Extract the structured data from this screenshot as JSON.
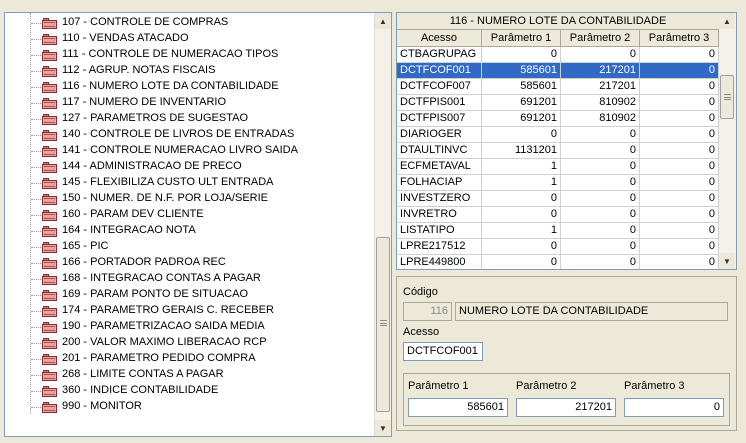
{
  "tree": {
    "items": [
      "107 - CONTROLE DE COMPRAS",
      "110 - VENDAS ATACADO",
      "111 - CONTROLE DE NUMERACAO TIPOS",
      "112 - AGRUP. NOTAS FISCAIS",
      "116 - NUMERO LOTE DA CONTABILIDADE",
      "117 - NUMERO DE INVENTARIO",
      "127 - PARAMETROS DE SUGESTAO",
      "140 - CONTROLE DE LIVROS DE ENTRADAS",
      "141 - CONTROLE NUMERACAO LIVRO SAIDA",
      "144 - ADMINISTRACAO DE PRECO",
      "145 - FLEXIBILIZA CUSTO ULT ENTRADA",
      "150 - NUMER. DE N.F. POR LOJA/SERIE",
      "160 - PARAM DEV CLIENTE",
      "164 - INTEGRACAO NOTA",
      "165 - PIC",
      "166 - PORTADOR PADROA REC",
      "168 - INTEGRACAO CONTAS A PAGAR",
      "169 - PARAM PONTO DE SITUACAO",
      "174 - PARAMETRO GERAIS C. RECEBER",
      "190 - PARAMETRIZACAO SAIDA MEDIA",
      "200 - VALOR MAXIMO LIBERACAO RCP",
      "201 - PARAMETRO PEDIDO COMPRA",
      "268 - LIMITE CONTAS A PAGAR",
      "360 - INDICE CONTABILIDADE",
      "990 - MONITOR"
    ]
  },
  "grid": {
    "title": "116 - NUMERO LOTE DA CONTABILIDADE",
    "columns": [
      "Acesso",
      "Parâmetro 1",
      "Parâmetro 2",
      "Parâmetro 3"
    ],
    "selected_index": 1,
    "rows": [
      [
        "CTBAGRUPAG",
        "0",
        "0",
        "0"
      ],
      [
        "DCTFCOF001",
        "585601",
        "217201",
        "0"
      ],
      [
        "DCTFCOF007",
        "585601",
        "217201",
        "0"
      ],
      [
        "DCTFPIS001",
        "691201",
        "810902",
        "0"
      ],
      [
        "DCTFPIS007",
        "691201",
        "810902",
        "0"
      ],
      [
        "DIARIOGER",
        "0",
        "0",
        "0"
      ],
      [
        "DTAULTINVC",
        "1131201",
        "0",
        "0"
      ],
      [
        "ECFMETAVAL",
        "1",
        "0",
        "0"
      ],
      [
        "FOLHACIAP",
        "1",
        "0",
        "0"
      ],
      [
        "INVESTZERO",
        "0",
        "0",
        "0"
      ],
      [
        "INVRETRO",
        "0",
        "0",
        "0"
      ],
      [
        "LISTATIPO",
        "1",
        "0",
        "0"
      ],
      [
        "LPRE217512",
        "0",
        "0",
        "0"
      ],
      [
        "LPRE449800",
        "0",
        "0",
        "0"
      ]
    ]
  },
  "detail": {
    "codigo_label": "Código",
    "codigo_value": "116",
    "descricao_value": "NUMERO LOTE DA CONTABILIDADE",
    "acesso_label": "Acesso",
    "acesso_value": "DCTFCOF001",
    "param1_label": "Parâmetro 1",
    "param1_value": "585601",
    "param2_label": "Parâmetro 2",
    "param2_value": "217201",
    "param3_label": "Parâmetro 3",
    "param3_value": "0"
  },
  "colors": {
    "selection": "#316ac5",
    "folder": "#e8a0a0"
  }
}
